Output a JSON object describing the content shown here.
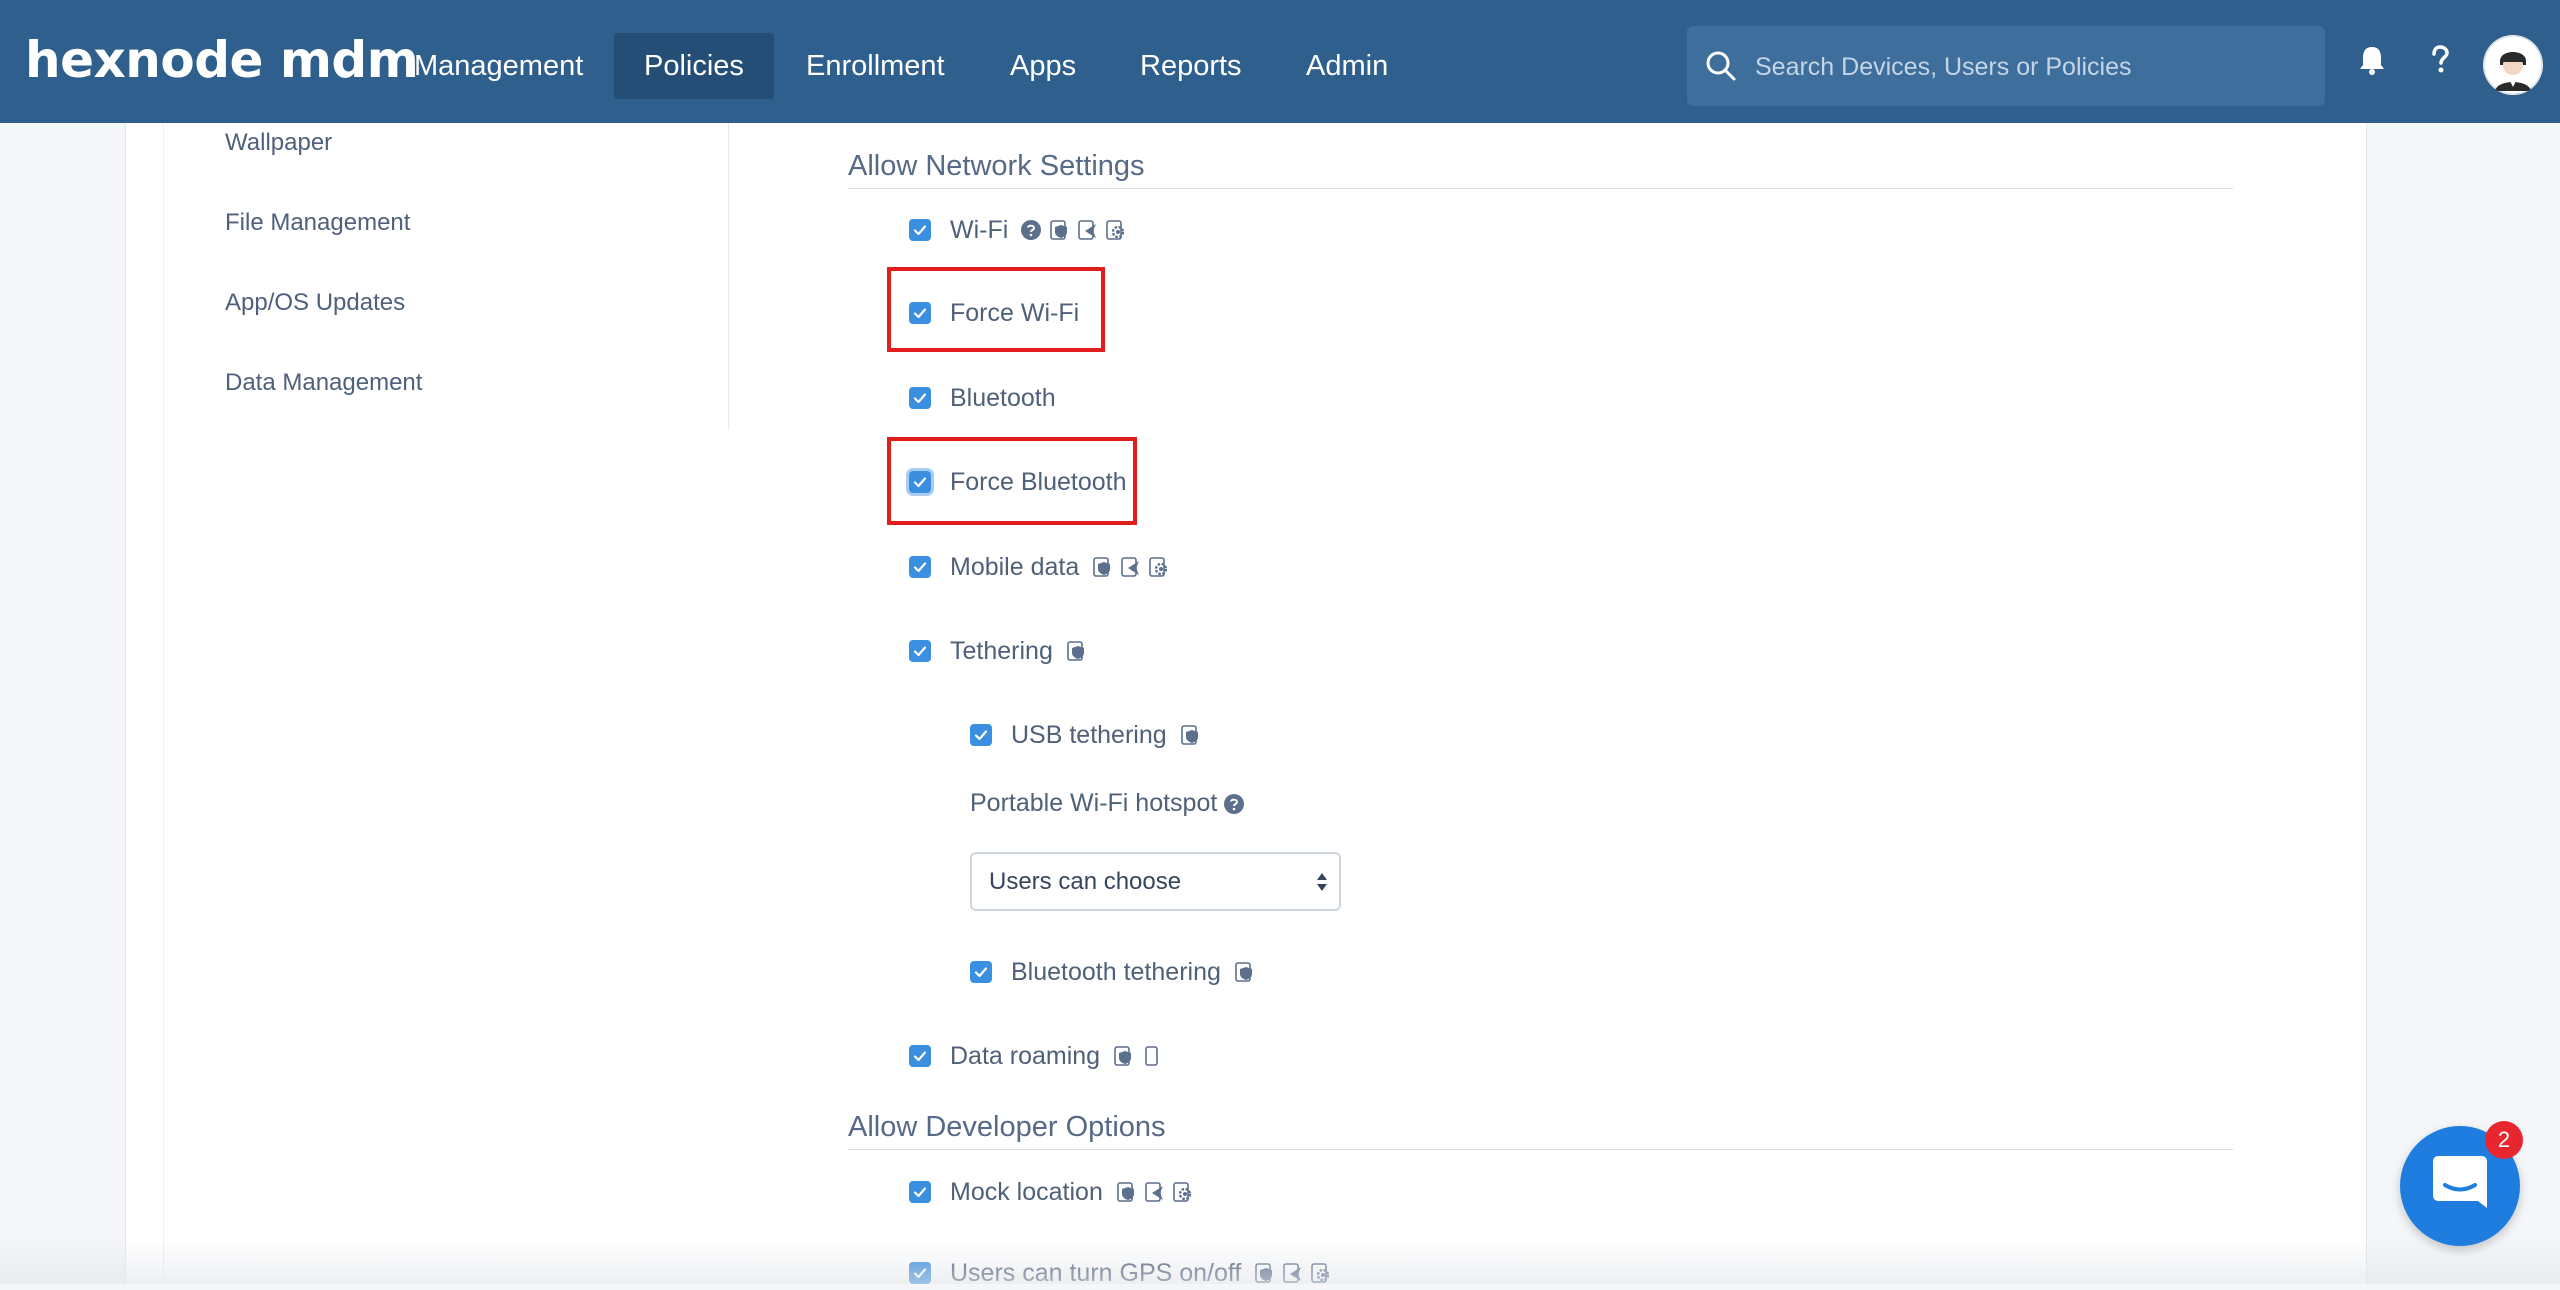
{
  "app": {
    "logo": "hexnode mdm"
  },
  "nav": {
    "items": [
      {
        "label": "Management"
      },
      {
        "label": "Policies"
      },
      {
        "label": "Enrollment"
      },
      {
        "label": "Apps"
      },
      {
        "label": "Reports"
      },
      {
        "label": "Admin"
      }
    ],
    "active": "Policies"
  },
  "search": {
    "placeholder": "Search Devices, Users or Policies",
    "value": ""
  },
  "sidebar": {
    "items": [
      {
        "label": "Wallpaper"
      },
      {
        "label": "File Management"
      },
      {
        "label": "App/OS Updates"
      },
      {
        "label": "Data Management"
      }
    ]
  },
  "network": {
    "title": "Allow Network Settings",
    "wifi": {
      "label": "Wi-Fi",
      "checked": true
    },
    "force_wifi": {
      "label": "Force Wi-Fi",
      "checked": true
    },
    "bluetooth": {
      "label": "Bluetooth",
      "checked": true
    },
    "force_bluetooth": {
      "label": "Force Bluetooth",
      "checked": true
    },
    "mobile_data": {
      "label": "Mobile data",
      "checked": true
    },
    "tethering": {
      "label": "Tethering",
      "checked": true
    },
    "usb_tethering": {
      "label": "USB tethering",
      "checked": true
    },
    "hotspot": {
      "label": "Portable Wi-Fi hotspot",
      "selected": "Users can choose"
    },
    "bt_tethering": {
      "label": "Bluetooth tethering",
      "checked": true
    },
    "data_roaming": {
      "label": "Data roaming",
      "checked": true
    }
  },
  "developer": {
    "title": "Allow Developer Options",
    "mock_location": {
      "label": "Mock location",
      "checked": true
    },
    "gps": {
      "label": "Users can turn GPS on/off",
      "checked": true
    }
  },
  "chat": {
    "badge": "2"
  },
  "colors": {
    "topbar": "#2f5f8c",
    "active_nav": "#254e77",
    "checkbox": "#3b8fe0",
    "highlight": "#e11d1d",
    "chat": "#1f7de0",
    "badge": "#e8262f"
  }
}
